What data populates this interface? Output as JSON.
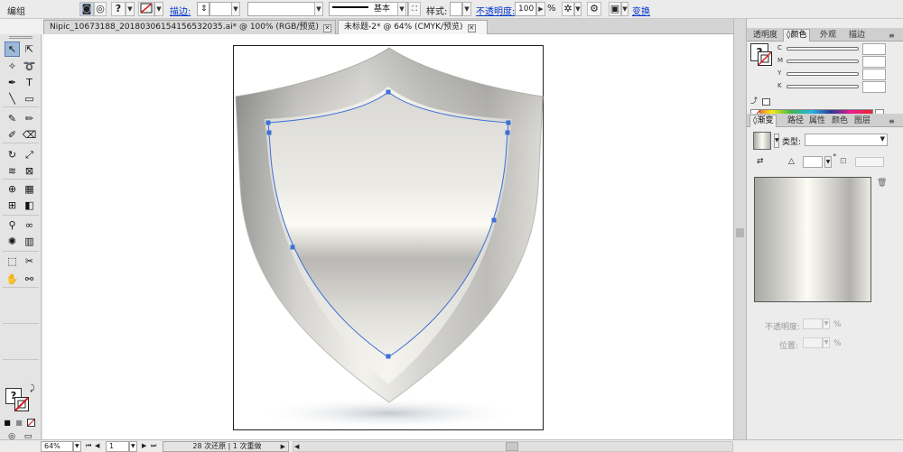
{
  "control_bar": {
    "group_label": "编组",
    "stroke_label": "描边:",
    "stroke_style_label": "基本",
    "style_label": "样式:",
    "opacity_label": "不透明度:",
    "opacity_value": "100",
    "opacity_unit": "%",
    "transform_label": "变换"
  },
  "tabs": [
    {
      "label": "Nipic_10673188_20180306154156532035.ai* @ 100% (RGB/预览)",
      "active": false
    },
    {
      "label": "未标题-2* @ 64% (CMYK/预览)",
      "active": true
    }
  ],
  "tools": [
    "selection-tool",
    "direct-selection-tool",
    "magic-wand-tool",
    "lasso-tool",
    "pen-tool",
    "type-tool",
    "line-segment-tool",
    "rectangle-tool",
    "paintbrush-tool",
    "pencil-tool",
    "blob-brush-tool",
    "eraser-tool",
    "rotate-tool",
    "scale-tool",
    "warp-tool",
    "free-transform-tool",
    "shape-builder-tool",
    "perspective-grid-tool",
    "mesh-tool",
    "gradient-tool",
    "eyedropper-tool",
    "blend-tool",
    "symbol-sprayer-tool",
    "column-graph-tool",
    "artboard-tool",
    "slice-tool",
    "hand-tool",
    "zoom-tool"
  ],
  "color_panel": {
    "tabs": [
      "透明度",
      "颜色",
      "外观",
      "描边"
    ],
    "active_tab": 1,
    "channels": [
      "C",
      "M",
      "Y",
      "K"
    ]
  },
  "gradient_panel": {
    "tabs": [
      "渐变",
      "路径",
      "属性",
      "颜色",
      "图层"
    ],
    "active_tab": 0,
    "type_label": "类型:",
    "opacity_label": "不透明度:",
    "opacity_unit": "%",
    "location_label": "位置:",
    "location_unit": "%",
    "angle_unit": "°",
    "stops": [
      "#a8a8a6",
      "#fdfcf5",
      "#b1b0ad",
      "#eceae4"
    ]
  },
  "status_bar": {
    "zoom": "64%",
    "artboard_number": "1",
    "history": "28 次还原 | 1 次重做"
  },
  "colors": {
    "path_highlight": "#3d6fd6",
    "stroke_none": "#d22020",
    "selection_tool_bg": "#9db8d9"
  }
}
